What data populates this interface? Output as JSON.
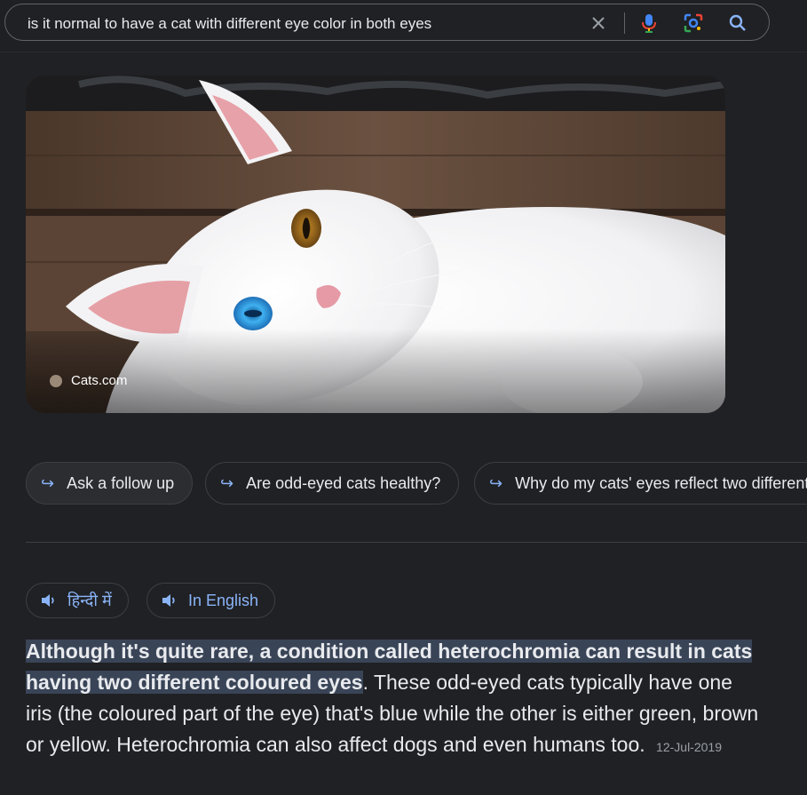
{
  "search": {
    "query": "is it normal to have a cat with different eye color in both eyes"
  },
  "image": {
    "source": "Cats.com"
  },
  "followups": [
    {
      "label": "Ask a follow up"
    },
    {
      "label": "Are odd-eyed cats healthy?"
    },
    {
      "label": "Why do my cats' eyes reflect two different"
    }
  ],
  "languages": [
    {
      "label": "हिन्दी में"
    },
    {
      "label": "In English"
    }
  ],
  "answer": {
    "highlight": "Although it's quite rare, a condition called heterochromia can result in cats having two different coloured eyes",
    "rest": ". These odd-eyed cats typically have one iris (the coloured part of the eye) that's blue while the other is either green, brown or yellow. Heterochromia can also affect dogs and even humans too.",
    "date": "12-Jul-2019"
  },
  "colors": {
    "background": "#202124",
    "accent": "#8ab4f8",
    "highlight": "#394457"
  }
}
